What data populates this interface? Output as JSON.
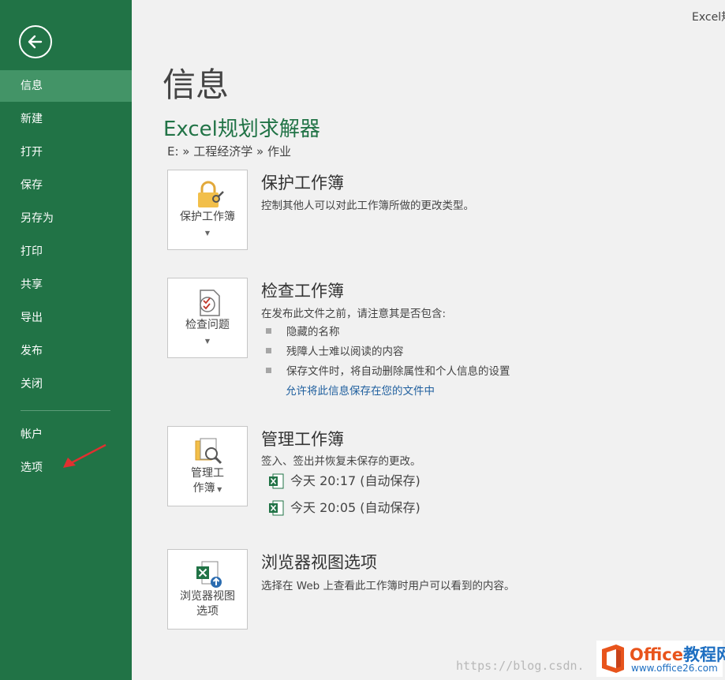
{
  "window": {
    "title_partial": "Excel规"
  },
  "sidebar": {
    "items": [
      {
        "label": "信息"
      },
      {
        "label": "新建"
      },
      {
        "label": "打开"
      },
      {
        "label": "保存"
      },
      {
        "label": "另存为"
      },
      {
        "label": "打印"
      },
      {
        "label": "共享"
      },
      {
        "label": "导出"
      },
      {
        "label": "发布"
      },
      {
        "label": "关闭"
      }
    ],
    "bottom_items": [
      {
        "label": "帐户"
      },
      {
        "label": "选项"
      }
    ]
  },
  "main": {
    "page_title": "信息",
    "doc_title": "Excel规划求解器",
    "breadcrumb": "E: » 工程经济学 » 作业",
    "protect": {
      "title": "保护工作簿",
      "desc": "控制其他人可以对此工作簿所做的更改类型。",
      "button_label": "保护工作簿",
      "icon": "lock-icon"
    },
    "inspect": {
      "title": "检查工作簿",
      "desc": "在发布此文件之前，请注意其是否包含:",
      "bullets": [
        "隐藏的名称",
        "残障人士难以阅读的内容",
        "保存文件时，将自动删除属性和个人信息的设置"
      ],
      "link": "允许将此信息保存在您的文件中",
      "button_label": "检查问题",
      "icon": "inspect-document-icon"
    },
    "manage": {
      "title": "管理工作簿",
      "desc": "签入、签出并恢复未保存的更改。",
      "button_line1": "管理工",
      "button_line2": "作簿",
      "icon": "manage-workbook-icon",
      "versions": [
        {
          "label": "今天 20:17 (自动保存)"
        },
        {
          "label": "今天 20:05 (自动保存)"
        }
      ]
    },
    "browser": {
      "title": "浏览器视图选项",
      "desc": "选择在 Web 上查看此工作簿时用户可以看到的内容。",
      "button_line1": "浏览器视图",
      "button_line2": "选项",
      "icon": "browser-view-icon"
    }
  },
  "overlay": {
    "watermark": "https://blog.csdn.",
    "logo_main_a": "Office",
    "logo_main_b": "教程网",
    "logo_url": "www.office26.com"
  },
  "colors": {
    "sidebar": "#217346",
    "active": "#439467",
    "accent": "#217346",
    "link": "#1f5f9e",
    "arrow": "#e03030"
  }
}
